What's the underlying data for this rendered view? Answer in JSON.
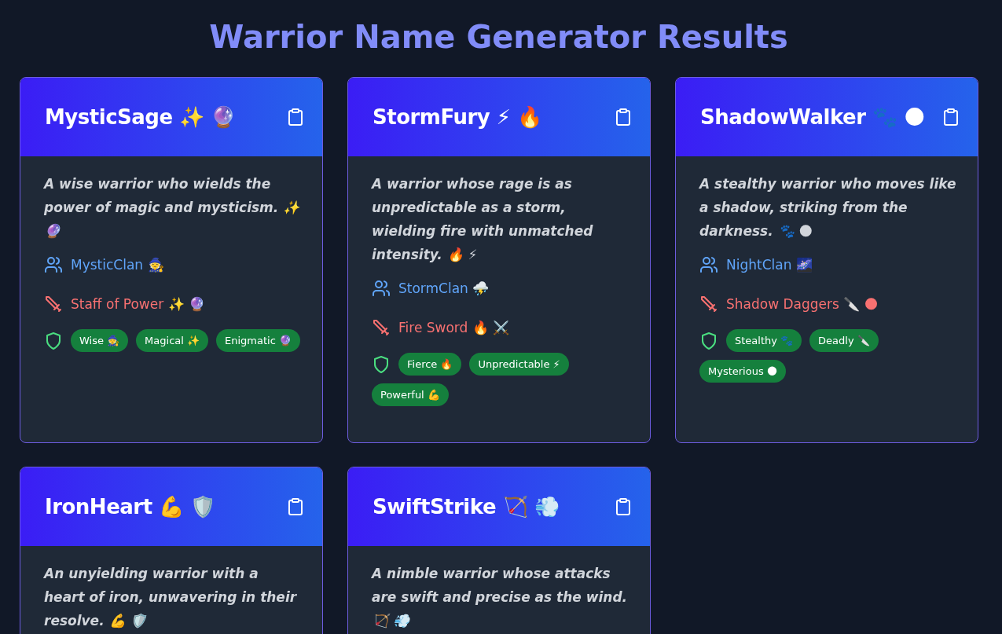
{
  "title": "Warrior Name Generator Results",
  "cards": [
    {
      "name": "MysticSage ✨ 🔮",
      "description": "A wise warrior who wields the power of magic and mysticism. ✨ 🔮",
      "clan": "MysticClan 🧙",
      "weapon": "Staff of Power ✨ 🔮",
      "traits": [
        "Wise 🧙",
        "Magical ✨",
        "Enigmatic 🔮"
      ]
    },
    {
      "name": "StormFury ⚡ 🔥",
      "description": "A warrior whose rage is as unpredictable as a storm, wielding fire with unmatched intensity. 🔥 ⚡",
      "clan": "StormClan ⛈️",
      "weapon": "Fire Sword 🔥 ⚔️",
      "traits": [
        "Fierce 🔥",
        "Unpredictable ⚡",
        "Powerful 💪"
      ]
    },
    {
      "name": "ShadowWalker 🐾 🌑",
      "description": "A stealthy warrior who moves like a shadow, striking from the darkness. 🐾 🌑",
      "clan": "NightClan 🌌",
      "weapon": "Shadow Daggers 🔪 🌑",
      "traits": [
        "Stealthy 🐾",
        "Deadly 🔪",
        "Mysterious 🌑"
      ]
    },
    {
      "name": "IronHeart 💪 🛡️",
      "description": "An unyielding warrior with a heart of iron, unwavering in their resolve. 💪 🛡️"
    },
    {
      "name": "SwiftStrike 🏹 💨",
      "description": "A nimble warrior whose attacks are swift and precise as the wind. 🏹 💨"
    }
  ]
}
